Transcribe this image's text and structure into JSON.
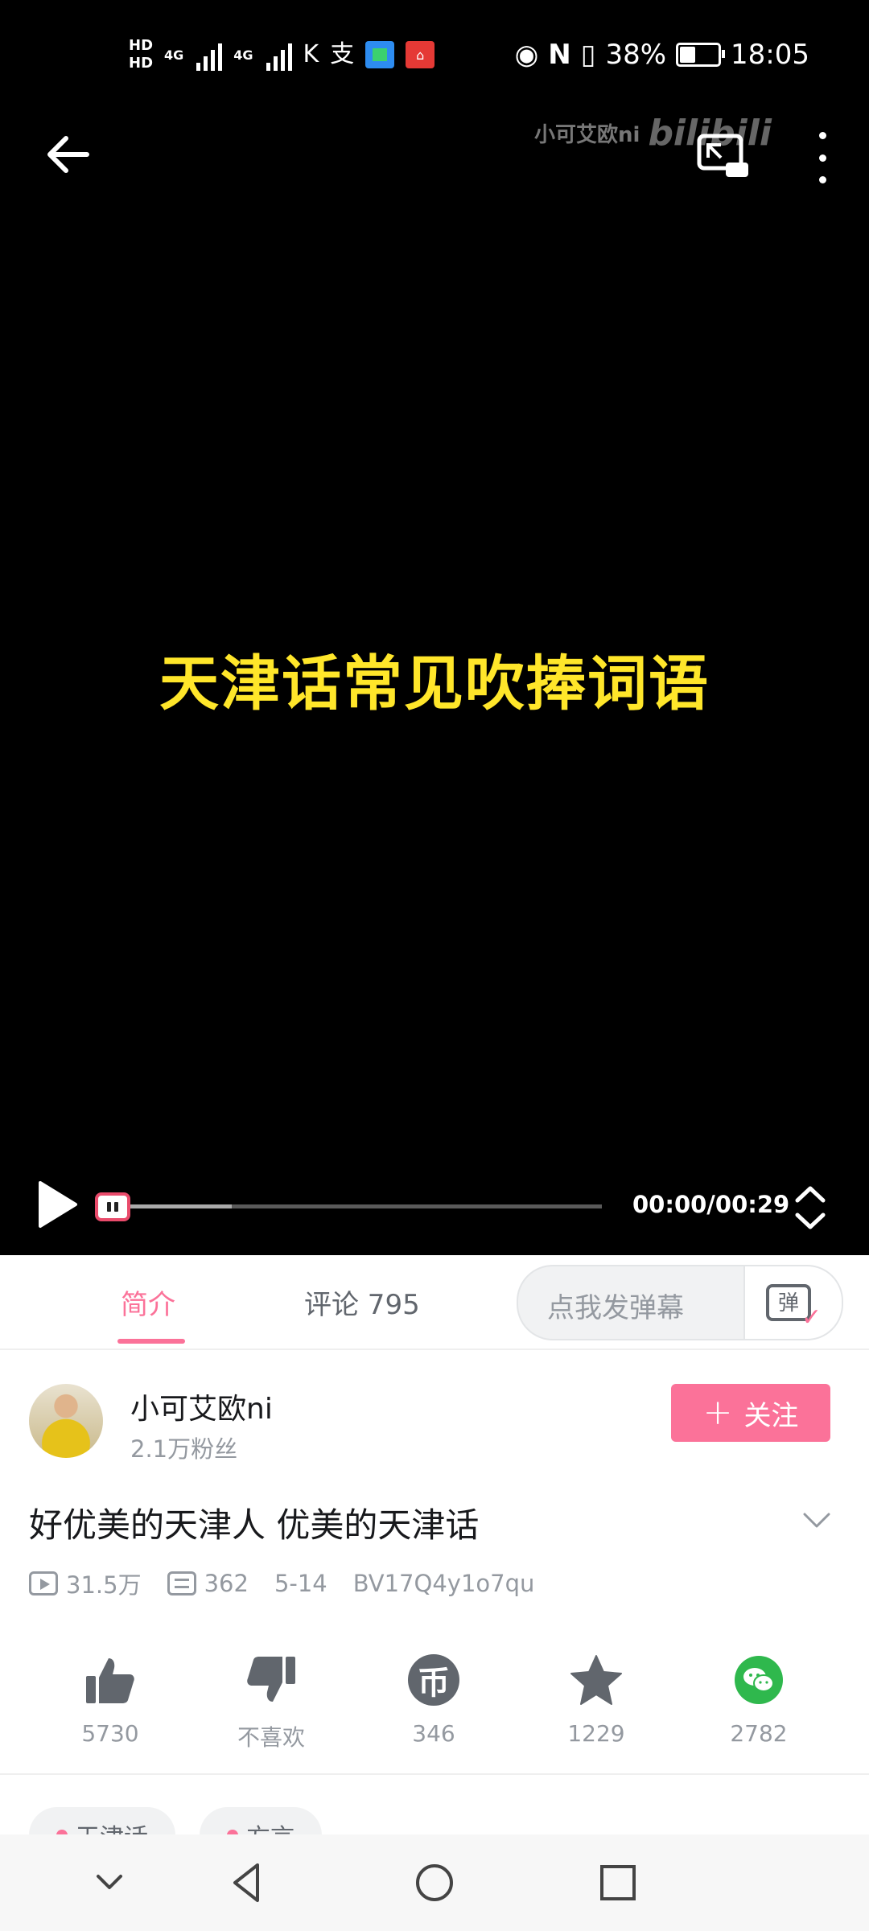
{
  "status_bar": {
    "hd1": "HD",
    "hd2": "HD",
    "net1": "4G",
    "net2": "4G",
    "battery": "38%",
    "battery_level": 0.38,
    "time": "18:05"
  },
  "video": {
    "watermark_channel": "小可艾欧ni",
    "watermark_brand": "bilibili",
    "caption": "天津话常见吹捧词语",
    "timecode": "00:00/00:29",
    "progress": 0,
    "buffered": 0.22
  },
  "tabs": {
    "intro": "简介",
    "comments": "评论 795"
  },
  "danmaku": {
    "placeholder": "点我发弹幕",
    "icon_text": "弹"
  },
  "uploader": {
    "name": "小可艾欧ni",
    "fans": "2.1万粉丝",
    "follow_plus": "+",
    "follow_label": "关注"
  },
  "video_info": {
    "title": "好优美的天津人 优美的天津话",
    "views": "31.5万",
    "danmaku_count": "362",
    "date": "5-14",
    "bvid": "BV17Q4y1o7qu"
  },
  "actions": {
    "like": "5730",
    "dislike": "不喜欢",
    "coin": "346",
    "coin_symbol": "币",
    "favorite": "1229",
    "share": "2782"
  },
  "tags": [
    "天津话",
    "方言"
  ],
  "colors": {
    "accent": "#fb7299",
    "caption": "#ffe62a",
    "wechat": "#2fb84d"
  }
}
